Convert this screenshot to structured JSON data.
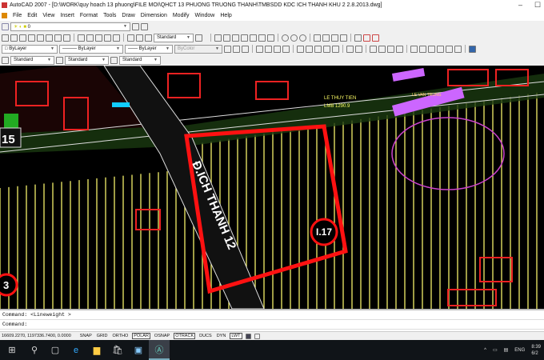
{
  "window": {
    "title": "AutoCAD 2007 - [D:\\WORK\\quy hoach 13 phuong\\FILE MOI\\QHCT 13 PHUONG TRUONG THANH\\TMBSDD KDC ICH THANH KHU 2 2.8.2013.dwg]",
    "minimize": "–",
    "maximize": "☐"
  },
  "menu": [
    "File",
    "Edit",
    "View",
    "Insert",
    "Format",
    "Tools",
    "Draw",
    "Dimension",
    "Modify",
    "Window",
    "Help"
  ],
  "toolbar": {
    "layer_value": "0",
    "text_style": "Standard",
    "color": "ByLayer",
    "linetype": "ByLayer",
    "lineweight": "ByLayer",
    "plotstyle": "ByColor",
    "style1": "Standard",
    "style2": "Standard",
    "style3": "Standard"
  },
  "drawing": {
    "road_label": "Đ.ICH THANH 12",
    "lot_label": "I.17",
    "left_label_1": "15",
    "left_label_2": "3",
    "street_1": "LE THUY TIEN",
    "street_1_sub": "LMB 1290.9",
    "street_2": "LE VAN TRUNG"
  },
  "command": {
    "history": "Command:  <Lineweight >",
    "prompt": "Command:"
  },
  "status": {
    "coords": "16609.2270, 1197336.7400, 0.0000",
    "buttons": [
      {
        "label": "SNAP",
        "on": false
      },
      {
        "label": "GRID",
        "on": false
      },
      {
        "label": "ORTHO",
        "on": false
      },
      {
        "label": "POLAR",
        "on": true
      },
      {
        "label": "OSNAP",
        "on": false
      },
      {
        "label": "OTRACK",
        "on": true
      },
      {
        "label": "DUCS",
        "on": false
      },
      {
        "label": "DYN",
        "on": false
      },
      {
        "label": "LWT",
        "on": true
      }
    ]
  },
  "taskbar": {
    "lang": "ENG",
    "time": "8:39",
    "date": "6/2"
  }
}
